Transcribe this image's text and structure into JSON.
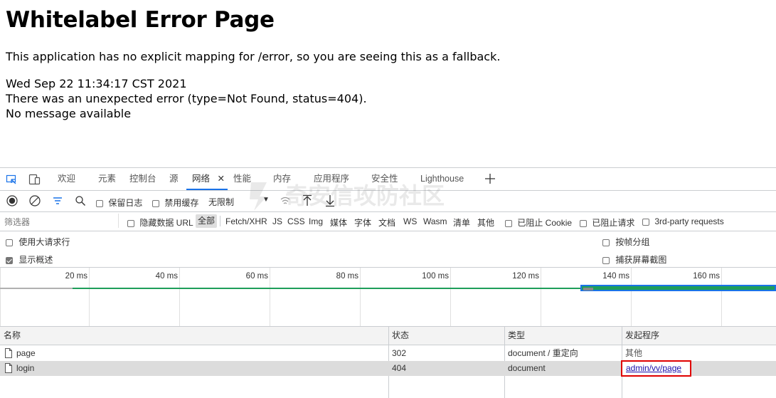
{
  "error_page": {
    "title": "Whitelabel Error Page",
    "message": "This application has no explicit mapping for /error, so you are seeing this as a fallback.",
    "timestamp": "Wed Sep 22 11:34:17 CST 2021",
    "error_detail": "There was an unexpected error (type=Not Found, status=404).",
    "no_message": "No message available"
  },
  "devtools": {
    "tabs": [
      "欢迎",
      "元素",
      "控制台",
      "源",
      "网络",
      "性能",
      "内存",
      "应用程序",
      "安全性",
      "Lighthouse"
    ],
    "active_tab": "网络",
    "toolbar": {
      "preserve_log": "保留日志",
      "disable_cache": "禁用缓存",
      "throttling": "无限制"
    },
    "filter": {
      "placeholder": "筛选器",
      "hide_data_urls": "隐藏数据 URL",
      "types": [
        "全部",
        "Fetch/XHR",
        "JS",
        "CSS",
        "Img",
        "媒体",
        "字体",
        "文档",
        "WS",
        "Wasm",
        "清单",
        "其他"
      ],
      "active_type": "全部",
      "blocked_cookies": "已阻止 Cookie",
      "blocked_requests": "已阻止请求",
      "third_party": "3rd-party requests"
    },
    "options": {
      "big_rows": "使用大请求行",
      "show_overview": "显示概述",
      "group_by_frame": "按帧分组",
      "capture_screenshots": "捕获屏幕截图"
    },
    "timeline_ticks": [
      "20 ms",
      "40 ms",
      "60 ms",
      "80 ms",
      "100 ms",
      "120 ms",
      "140 ms",
      "160 ms"
    ],
    "table": {
      "headers": [
        "名称",
        "状态",
        "类型",
        "发起程序"
      ],
      "rows": [
        {
          "name": "page",
          "status": "302",
          "type": "document / 重定向",
          "initiator": "其他"
        },
        {
          "name": "login",
          "status": "404",
          "type": "document",
          "initiator": "admin/vv/page"
        }
      ]
    },
    "colors": {
      "accent": "#1a73e8",
      "highlight": "#e00000",
      "timeline_green": "#1e9e5a"
    }
  },
  "watermark": "奇安信攻防社区"
}
